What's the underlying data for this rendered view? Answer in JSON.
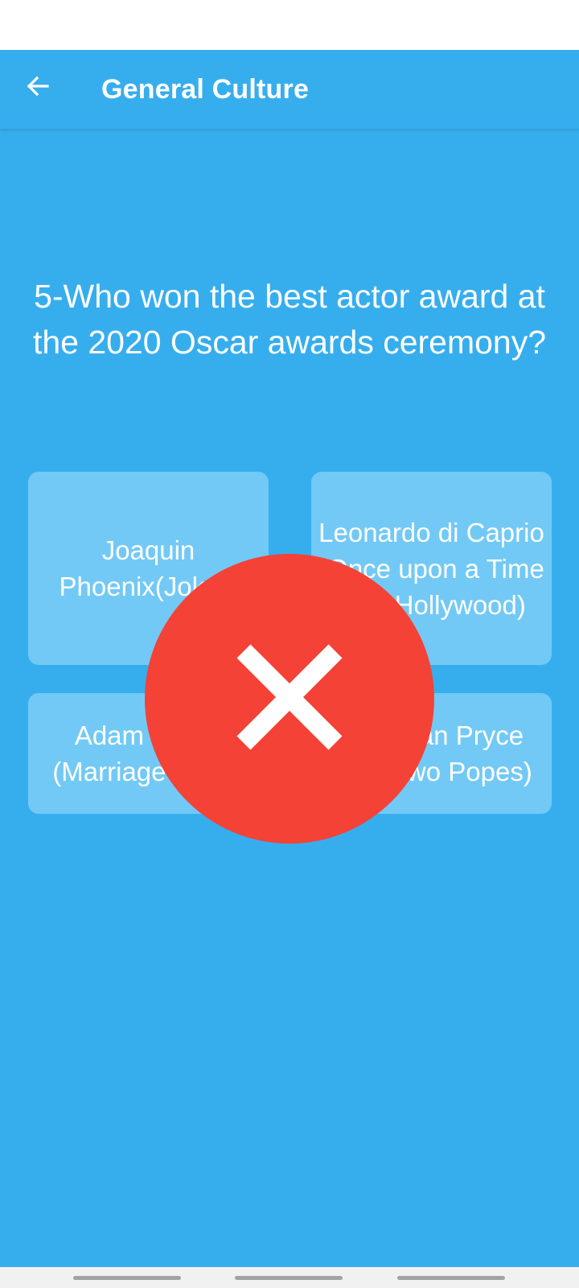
{
  "app_bar": {
    "title": "General Culture",
    "back_icon": "arrow-left-icon"
  },
  "question": {
    "text": "5-Who won the best actor award at the 2020 Oscar awards ceremony?"
  },
  "answers": [
    {
      "label": "Joaquin Phoenix(Joker)"
    },
    {
      "label": "Leonardo di Caprio (Once upon a Time ... in Hollywood)"
    },
    {
      "label": "Adam Driver (Marriage Story)"
    },
    {
      "label": "Jonathan Pryce (The Two Popes)"
    }
  ],
  "feedback": {
    "icon": "close-icon",
    "result": "wrong"
  },
  "colors": {
    "background": "#36AEEE",
    "card": "#72C9F6",
    "wrong": "#F44236",
    "text": "#FFFFFF"
  }
}
